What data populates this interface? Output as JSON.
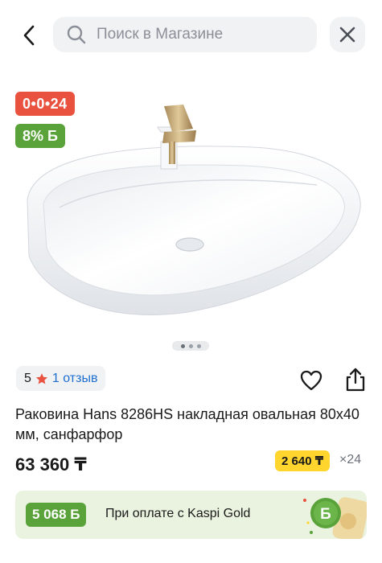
{
  "header": {
    "search_placeholder": "Поиск в Магазине",
    "back_icon": "chevron-left-icon",
    "search_icon": "search-icon",
    "close_icon": "close-icon"
  },
  "gallery": {
    "timer_badge": "0•0•24",
    "bonus_badge": "8% Б",
    "timer_color": "#e8523f",
    "bonus_color": "#5aa23a",
    "dots_count": 3
  },
  "rating": {
    "value": "5",
    "star_icon": "star-icon",
    "star_color": "#e8523f",
    "reviews": "1 отзыв"
  },
  "actions": {
    "favorite_icon": "heart-icon",
    "share_icon": "share-icon"
  },
  "product": {
    "title": "Раковина Hans 8286HS накладная овальная 80х40 мм, санфарфор",
    "price": "63 360 ₸"
  },
  "installment": {
    "monthly": "2 640 ₸",
    "term": "×24",
    "color": "#ffd52e"
  },
  "kaspi": {
    "bonus": "5 068 Б",
    "text": "При оплате с Kaspi Gold",
    "bg_color": "#e9f3df"
  }
}
